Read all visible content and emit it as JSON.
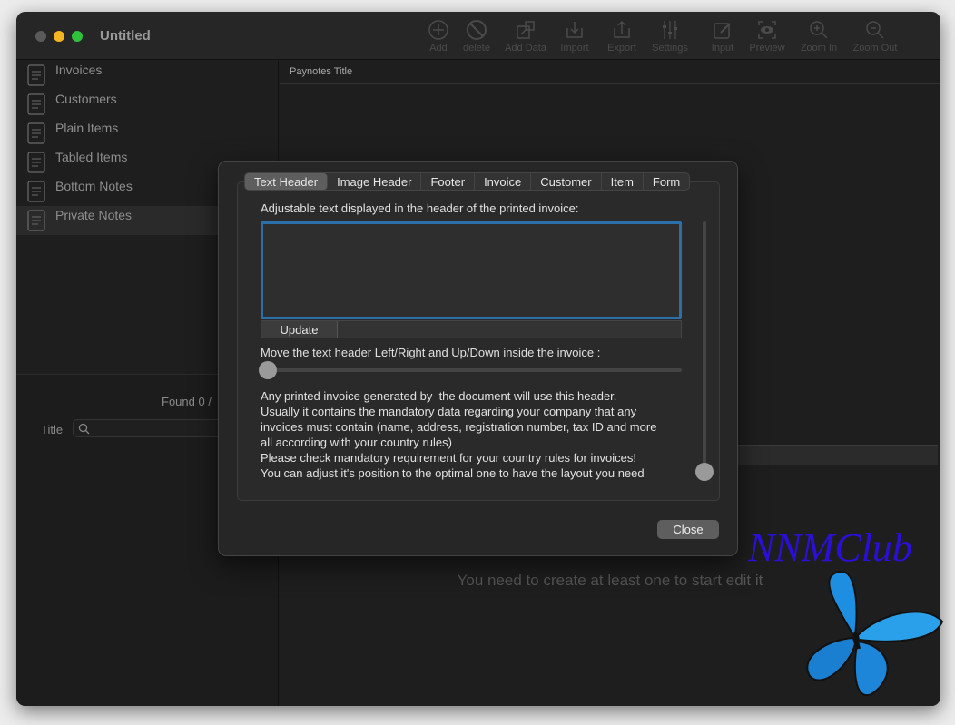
{
  "window": {
    "title": "Untitled"
  },
  "toolbar": [
    {
      "label": "Add",
      "icon": "plus-circle-icon"
    },
    {
      "label": "delete",
      "icon": "no-entry-icon"
    },
    {
      "label": "Add Data",
      "icon": "add-data-icon"
    },
    {
      "label": "Import",
      "icon": "import-icon"
    },
    {
      "label": "Export",
      "icon": "export-icon"
    },
    {
      "label": "Settings",
      "icon": "sliders-icon"
    },
    {
      "label": "Input",
      "icon": "pencil-icon"
    },
    {
      "label": "Preview",
      "icon": "eye-icon"
    },
    {
      "label": "Zoom In",
      "icon": "zoom-in-icon"
    },
    {
      "label": "Zoom Out",
      "icon": "zoom-out-icon"
    }
  ],
  "sidebar": {
    "items": [
      {
        "label": "Invoices"
      },
      {
        "label": "Customers"
      },
      {
        "label": "Plain Items"
      },
      {
        "label": "Tabled Items"
      },
      {
        "label": "Bottom Notes"
      },
      {
        "label": "Private Notes"
      }
    ]
  },
  "lower": {
    "found": "Found 0 /",
    "title_label": "Title",
    "search_placeholder": ""
  },
  "main": {
    "column_header": "Paynotes Title",
    "empty_message": "You need to create at least one to start edit it"
  },
  "dialog": {
    "tabs": [
      "Text Header",
      "Image Header",
      "Footer",
      "Invoice",
      "Customer",
      "Item",
      "Form"
    ],
    "active_tab": "Text Header",
    "textarea_label": "Adjustable text displayed in the header of the printed invoice:",
    "textarea_value": "",
    "update_label": "Update",
    "slider_label": "Move the text header Left/Right and Up/Down inside the invoice :",
    "horizontal_position": 0,
    "vertical_position": 0,
    "info_lines": [
      "Any printed invoice generated by  the document will use this header.",
      "Usually it contains the mandatory data regarding your company that any",
      "invoices must contain (name, address, registration number, tax ID and more",
      "all according with your country rules)",
      "Please check mandatory requirement for your country rules for invoices!",
      "You can adjust it's position to the optimal one to have the layout you need"
    ],
    "close_label": "Close"
  },
  "watermark": {
    "text": "NNMClub",
    "color": "#2a0fd6"
  },
  "colors": {
    "accent": "#2a6fa8"
  }
}
